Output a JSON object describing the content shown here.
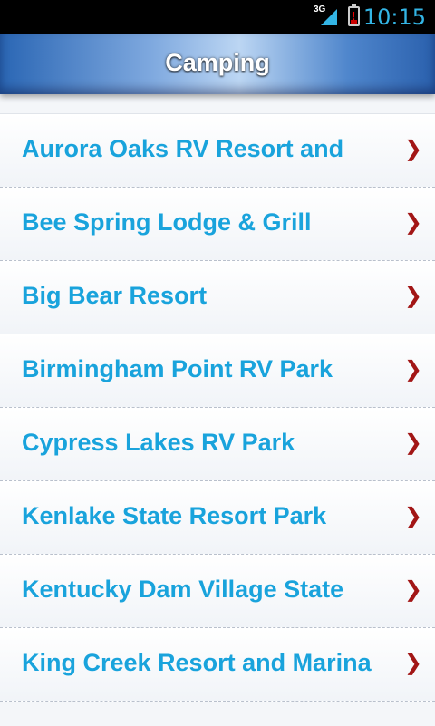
{
  "status_bar": {
    "network": "3G",
    "time": "10:15"
  },
  "header": {
    "title": "Camping"
  },
  "list": {
    "items": [
      {
        "label": "Aurora Oaks RV Resort and"
      },
      {
        "label": "Bee Spring Lodge & Grill"
      },
      {
        "label": "Big Bear Resort"
      },
      {
        "label": "Birmingham Point RV Park"
      },
      {
        "label": "Cypress Lakes RV Park"
      },
      {
        "label": "Kenlake State Resort Park"
      },
      {
        "label": "Kentucky Dam Village State"
      },
      {
        "label": "King Creek Resort and Marina"
      }
    ],
    "chevron_icon": "chevron-right-icon"
  },
  "colors": {
    "accent": "#19a3dc",
    "chevron": "#a21616",
    "time": "#33b5e5"
  }
}
